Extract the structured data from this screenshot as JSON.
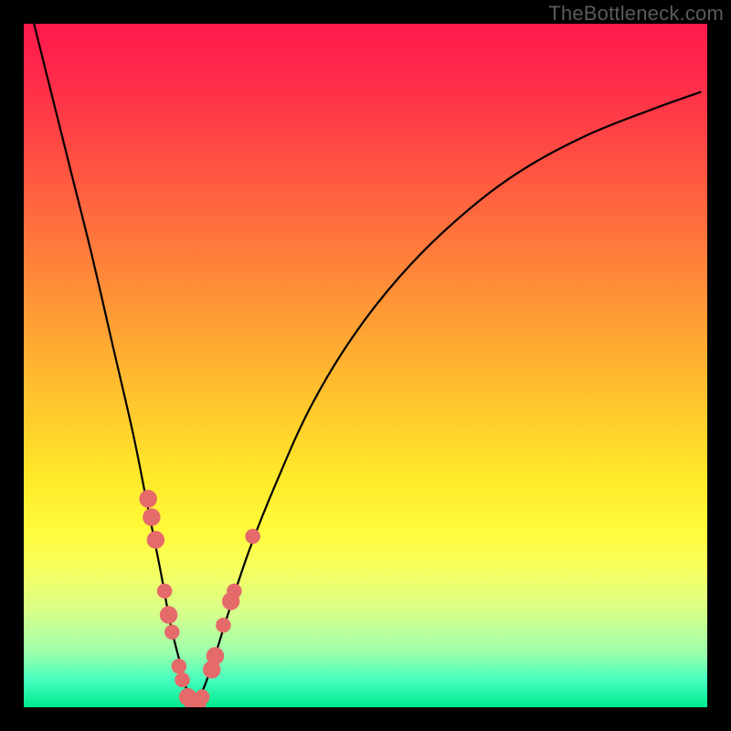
{
  "watermark": "TheBottleneck.com",
  "chart_data": {
    "type": "line",
    "title": "",
    "xlabel": "",
    "ylabel": "",
    "xlim": [
      0,
      100
    ],
    "ylim": [
      0,
      100
    ],
    "series": [
      {
        "name": "bottleneck-curve",
        "x": [
          1.5,
          4,
          7,
          10,
          13,
          16,
          18,
          20,
          21.5,
          23,
          24,
          25,
          26,
          27.5,
          30,
          33,
          37,
          42,
          48,
          55,
          63,
          72,
          82,
          92,
          99
        ],
        "y": [
          100,
          90,
          78,
          66,
          53,
          40,
          30,
          20,
          12,
          6,
          2,
          0,
          2,
          6,
          14,
          23,
          33,
          44,
          54,
          63,
          71,
          78,
          83.5,
          87.5,
          90
        ]
      }
    ],
    "markers": {
      "name": "highlight-dots",
      "points": [
        {
          "x": 18.2,
          "y": 30.5,
          "r": 1.3
        },
        {
          "x": 18.7,
          "y": 27.8,
          "r": 1.3
        },
        {
          "x": 19.3,
          "y": 24.5,
          "r": 1.3
        },
        {
          "x": 20.6,
          "y": 17.0,
          "r": 1.1
        },
        {
          "x": 21.2,
          "y": 13.5,
          "r": 1.3
        },
        {
          "x": 21.7,
          "y": 11.0,
          "r": 1.1
        },
        {
          "x": 22.7,
          "y": 6.0,
          "r": 1.1
        },
        {
          "x": 23.2,
          "y": 4.0,
          "r": 1.1
        },
        {
          "x": 24.0,
          "y": 1.5,
          "r": 1.3
        },
        {
          "x": 24.5,
          "y": 0.7,
          "r": 1.1
        },
        {
          "x": 25.0,
          "y": 0.2,
          "r": 1.1
        },
        {
          "x": 25.6,
          "y": 0.5,
          "r": 1.1
        },
        {
          "x": 26.1,
          "y": 1.5,
          "r": 1.1
        },
        {
          "x": 27.5,
          "y": 5.5,
          "r": 1.3
        },
        {
          "x": 28.0,
          "y": 7.5,
          "r": 1.3
        },
        {
          "x": 29.2,
          "y": 12.0,
          "r": 1.1
        },
        {
          "x": 30.3,
          "y": 15.5,
          "r": 1.3
        },
        {
          "x": 30.8,
          "y": 17.0,
          "r": 1.1
        },
        {
          "x": 33.5,
          "y": 25.0,
          "r": 1.1
        }
      ]
    }
  }
}
